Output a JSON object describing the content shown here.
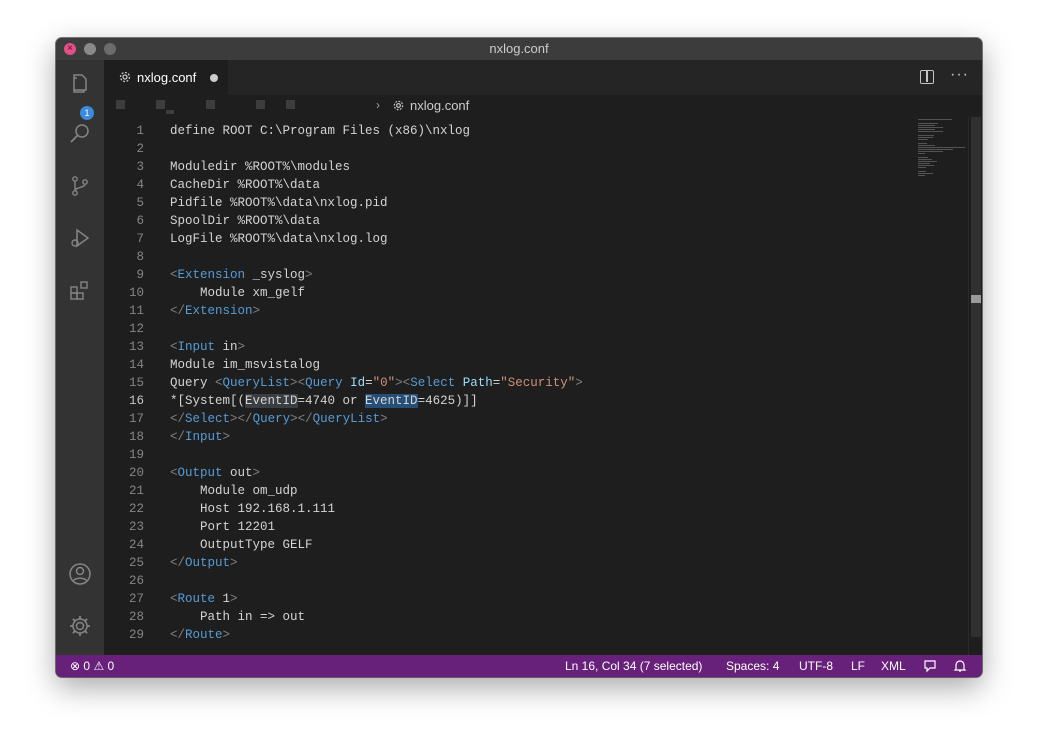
{
  "window": {
    "title": "nxlog.conf"
  },
  "activity_bar": {
    "items": [
      {
        "icon": "files-icon",
        "badge": "1"
      },
      {
        "icon": "search-icon"
      },
      {
        "icon": "source-control-icon"
      },
      {
        "icon": "run-debug-icon"
      },
      {
        "icon": "extensions-icon"
      }
    ],
    "bottom": [
      {
        "icon": "account-icon"
      },
      {
        "icon": "settings-gear-icon"
      }
    ]
  },
  "tab": {
    "label": "nxlog.conf",
    "dirty": true
  },
  "breadcrumb": {
    "file": "nxlog.conf"
  },
  "editor": {
    "active_line": 16,
    "lines": [
      {
        "n": "1",
        "t": "define ROOT C:\\Program Files (x86)\\nxlog"
      },
      {
        "n": "2",
        "t": ""
      },
      {
        "n": "3",
        "t": "Moduledir %ROOT%\\modules"
      },
      {
        "n": "4",
        "t": "CacheDir %ROOT%\\data"
      },
      {
        "n": "5",
        "t": "Pidfile %ROOT%\\data\\nxlog.pid"
      },
      {
        "n": "6",
        "t": "SpoolDir %ROOT%\\data"
      },
      {
        "n": "7",
        "t": "LogFile %ROOT%\\data\\nxlog.log"
      },
      {
        "n": "8",
        "t": ""
      },
      {
        "n": "9",
        "t": "<Extension _syslog>"
      },
      {
        "n": "10",
        "t": "    Module xm_gelf"
      },
      {
        "n": "11",
        "t": "</Extension>"
      },
      {
        "n": "12",
        "t": ""
      },
      {
        "n": "13",
        "t": "<Input in>"
      },
      {
        "n": "14",
        "t": "Module im_msvistalog"
      },
      {
        "n": "15",
        "t": "Query <QueryList><Query Id=\"0\"><Select Path=\"Security\">"
      },
      {
        "n": "16",
        "t": "*[System[(EventID=4740 or EventID=4625)]]"
      },
      {
        "n": "17",
        "t": "</Select></Query></QueryList>"
      },
      {
        "n": "18",
        "t": "</Input>"
      },
      {
        "n": "19",
        "t": ""
      },
      {
        "n": "20",
        "t": "<Output out>"
      },
      {
        "n": "21",
        "t": "    Module om_udp"
      },
      {
        "n": "22",
        "t": "    Host 192.168.1.111"
      },
      {
        "n": "23",
        "t": "    Port 12201"
      },
      {
        "n": "24",
        "t": "    OutputType GELF"
      },
      {
        "n": "25",
        "t": "</Output>"
      },
      {
        "n": "26",
        "t": ""
      },
      {
        "n": "27",
        "t": "<Route 1>"
      },
      {
        "n": "28",
        "t": "    Path in => out"
      },
      {
        "n": "29",
        "t": "</Route>"
      }
    ]
  },
  "status_bar": {
    "errors": "0",
    "warnings": "0",
    "cursor": "Ln 16, Col 34 (7 selected)",
    "spaces": "Spaces: 4",
    "encoding": "UTF-8",
    "eol": "LF",
    "language": "XML",
    "colors": {
      "background": "#68217a"
    }
  }
}
